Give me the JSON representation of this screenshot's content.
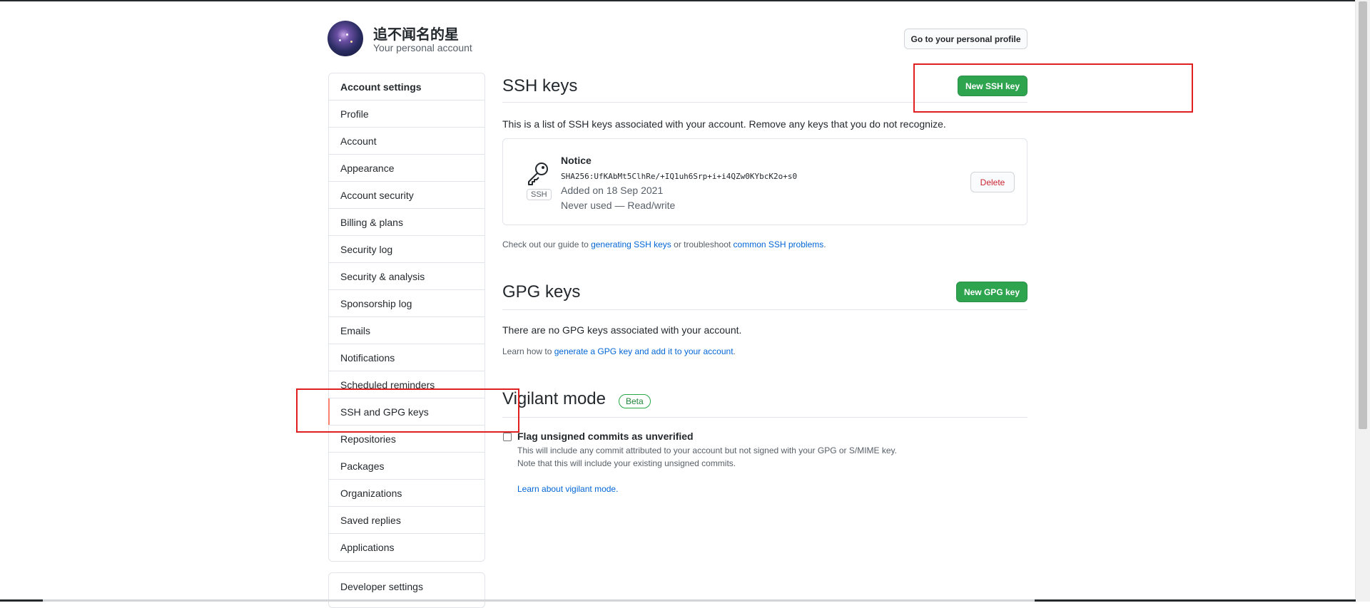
{
  "header": {
    "username": "追不闻名的星",
    "subtitle": "Your personal account",
    "profile_button": "Go to your personal profile"
  },
  "sidebar": {
    "heading": "Account settings",
    "items": [
      {
        "label": "Profile"
      },
      {
        "label": "Account"
      },
      {
        "label": "Appearance"
      },
      {
        "label": "Account security"
      },
      {
        "label": "Billing & plans"
      },
      {
        "label": "Security log"
      },
      {
        "label": "Security & analysis"
      },
      {
        "label": "Sponsorship log"
      },
      {
        "label": "Emails"
      },
      {
        "label": "Notifications"
      },
      {
        "label": "Scheduled reminders"
      },
      {
        "label": "SSH and GPG keys",
        "selected": true
      },
      {
        "label": "Repositories"
      },
      {
        "label": "Packages"
      },
      {
        "label": "Organizations"
      },
      {
        "label": "Saved replies"
      },
      {
        "label": "Applications"
      }
    ],
    "developer_settings": "Developer settings"
  },
  "ssh": {
    "title": "SSH keys",
    "new_button": "New SSH key",
    "description": "This is a list of SSH keys associated with your account. Remove any keys that you do not recognize.",
    "key": {
      "type_label": "SSH",
      "title": "Notice",
      "fingerprint": "SHA256:UfKAbMt5ClhRe/+IQ1uh6Srp+i+i4QZw0KYbcK2o+s0",
      "added": "Added on 18 Sep 2021",
      "usage": "Never used — Read/write",
      "delete_button": "Delete"
    },
    "guide": {
      "prefix": "Check out our guide to ",
      "link1": "generating SSH keys",
      "middle": " or troubleshoot ",
      "link2": "common SSH problems",
      "suffix": "."
    }
  },
  "gpg": {
    "title": "GPG keys",
    "new_button": "New GPG key",
    "empty": "There are no GPG keys associated with your account.",
    "learn_prefix": "Learn how to ",
    "learn_link": "generate a GPG key and add it to your account",
    "learn_suffix": "."
  },
  "vigilant": {
    "title": "Vigilant mode",
    "badge": "Beta",
    "checkbox_label": "Flag unsigned commits as unverified",
    "checked": false,
    "note1": "This will include any commit attributed to your account but not signed with your GPG or S/MIME key.",
    "note2": "Note that this will include your existing unsigned commits.",
    "learn_link": "Learn about vigilant mode."
  },
  "colors": {
    "accent_green": "#2ea44f",
    "link_blue": "#0366d6",
    "danger_red": "#cb2431",
    "annotation_red": "#e02020",
    "selected_marker": "#f9826c"
  }
}
